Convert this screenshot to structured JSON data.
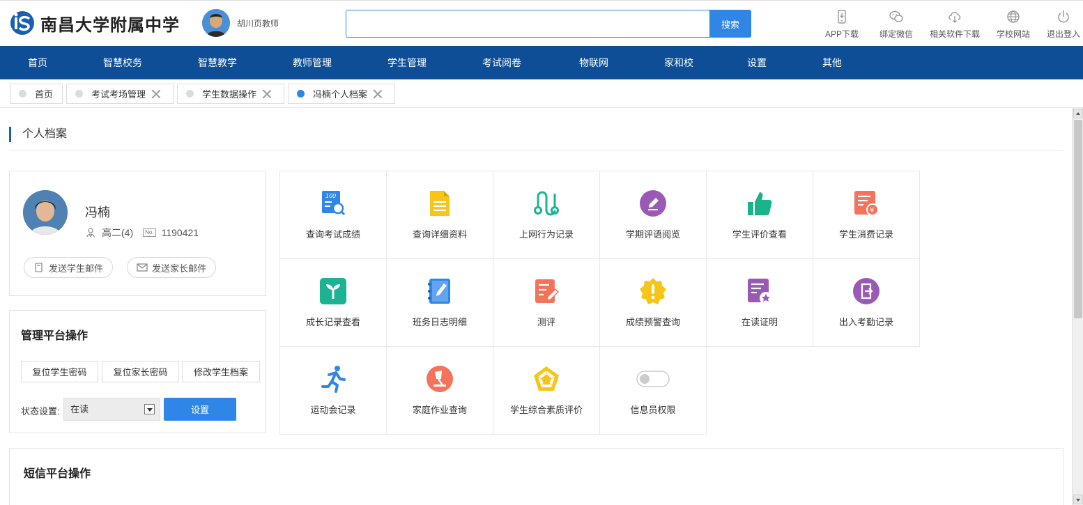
{
  "header": {
    "school_name": "南昌大学附属中学",
    "teacher_name": "胡川页教师",
    "search": {
      "value": "",
      "placeholder": "",
      "button_label": "搜索"
    },
    "tools": [
      {
        "label": "APP下载",
        "icon": "phone-download-icon"
      },
      {
        "label": "绑定微信",
        "icon": "wechat-icon"
      },
      {
        "label": "相关软件下载",
        "icon": "cloud-download-icon"
      },
      {
        "label": "学校网站",
        "icon": "globe-icon"
      },
      {
        "label": "退出登入",
        "icon": "power-icon"
      }
    ]
  },
  "nav": {
    "items": [
      "首页",
      "智慧校务",
      "智慧教学",
      "教师管理",
      "学生管理",
      "考试阅卷",
      "物联网",
      "家和校",
      "设置",
      "其他"
    ]
  },
  "tabs": [
    {
      "label": "首页",
      "closable": false,
      "active": false
    },
    {
      "label": "考试考场管理",
      "closable": true,
      "active": false
    },
    {
      "label": "学生数据操作",
      "closable": true,
      "active": false
    },
    {
      "label": "冯楠个人档案",
      "closable": true,
      "active": true
    }
  ],
  "page": {
    "section_title": "个人档案",
    "student": {
      "name": "冯楠",
      "class": "高二(4)",
      "number_badge": "No.",
      "number": "1190421",
      "send_student_mail": "发送学生邮件",
      "send_parent_mail": "发送家长邮件"
    },
    "management": {
      "title": "管理平台操作",
      "reset_student_password": "复位学生密码",
      "reset_parent_password": "复位家长密码",
      "edit_student_file": "修改学生档案",
      "status_label": "状态设置:",
      "status_value": "在读",
      "set_button": "设置"
    },
    "functions": [
      {
        "label": "查询考试成绩",
        "icon": "exam-score-icon",
        "color": "#2f86e6"
      },
      {
        "label": "查询详细资料",
        "icon": "document-icon",
        "color": "#f5c518"
      },
      {
        "label": "上网行为记录",
        "icon": "route-icon",
        "color": "#1ab394"
      },
      {
        "label": "学期评语阅览",
        "icon": "edit-circle-icon",
        "color": "#9b59b6"
      },
      {
        "label": "学生评价查看",
        "icon": "thumbs-up-icon",
        "color": "#1ab38c"
      },
      {
        "label": "学生消费记录",
        "icon": "bill-yuan-icon",
        "color": "#f4735a"
      },
      {
        "label": "成长记录查看",
        "icon": "sprout-icon",
        "color": "#1ab394"
      },
      {
        "label": "班务日志明细",
        "icon": "notebook-icon",
        "color": "#2f86e6"
      },
      {
        "label": "测评",
        "icon": "checklist-icon",
        "color": "#f4735a"
      },
      {
        "label": "成绩预警查询",
        "icon": "warning-badge-icon",
        "color": "#f5c518"
      },
      {
        "label": "在读证明",
        "icon": "certificate-icon",
        "color": "#9b59b6"
      },
      {
        "label": "出入考勤记录",
        "icon": "attendance-icon",
        "color": "#9b59b6"
      },
      {
        "label": "运动会记录",
        "icon": "runner-icon",
        "color": "#2f86e6"
      },
      {
        "label": "家庭作业查询",
        "icon": "lamp-icon",
        "color": "#f4735a"
      },
      {
        "label": "学生综合素质评价",
        "icon": "pentagon-icon",
        "color": "#f5c518"
      },
      {
        "label": "信息员权限",
        "icon": "toggle-icon",
        "color": "#cccccc"
      }
    ],
    "sms_title": "短信平台操作"
  }
}
